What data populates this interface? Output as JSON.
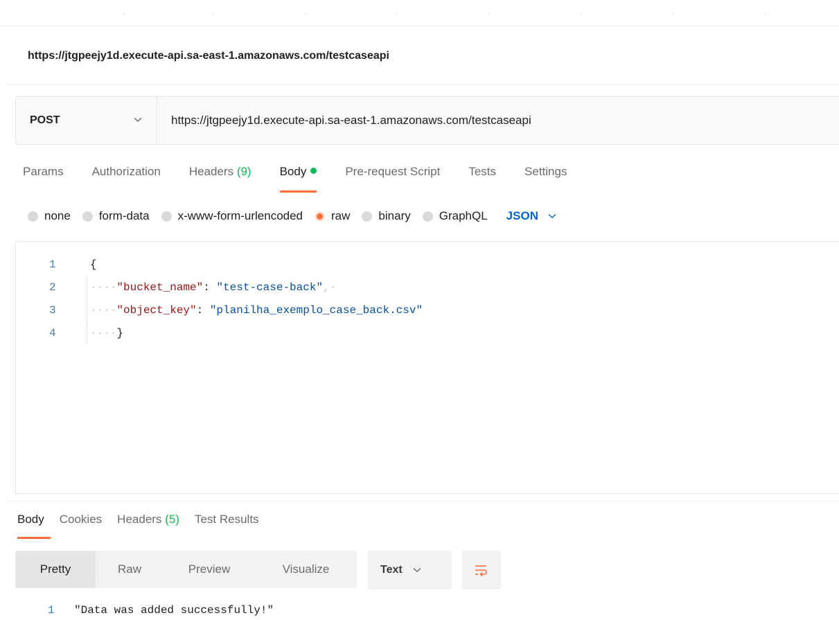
{
  "request": {
    "name": "https://jtgpeejy1d.execute-api.sa-east-1.amazonaws.com/testcaseapi",
    "method": "POST",
    "url": "https://jtgpeejy1d.execute-api.sa-east-1.amazonaws.com/testcaseapi"
  },
  "request_tabs": {
    "params": "Params",
    "authorization": "Authorization",
    "headers_label": "Headers",
    "headers_count": "(9)",
    "body": "Body",
    "prerequest": "Pre-request Script",
    "tests": "Tests",
    "settings": "Settings"
  },
  "body_types": {
    "none": "none",
    "form_data": "form-data",
    "urlencoded": "x-www-form-urlencoded",
    "raw": "raw",
    "binary": "binary",
    "graphql": "GraphQL",
    "language": "JSON"
  },
  "editor": {
    "lines": [
      {
        "n": "1",
        "open": "{"
      },
      {
        "n": "2",
        "ws": "····",
        "key": "\"bucket_name\"",
        "sep": ": ",
        "val": "\"test-case-back\"",
        "tail": ",·"
      },
      {
        "n": "3",
        "ws": "····",
        "key": "\"object_key\"",
        "sep": ": ",
        "val": "\"planilha_exemplo_case_back.csv\""
      },
      {
        "n": "4",
        "ws": "····",
        "close": "}"
      }
    ]
  },
  "response_tabs": {
    "body": "Body",
    "cookies": "Cookies",
    "headers_label": "Headers",
    "headers_count": "(5)",
    "test_results": "Test Results"
  },
  "response_view": {
    "pretty": "Pretty",
    "raw": "Raw",
    "preview": "Preview",
    "visualize": "Visualize",
    "format": "Text"
  },
  "response_body": {
    "line_no": "1",
    "text": "\"Data was added successfully!\""
  },
  "colors": {
    "accent": "#ff6c37",
    "success": "#0cbb52",
    "link": "#0265d2"
  }
}
